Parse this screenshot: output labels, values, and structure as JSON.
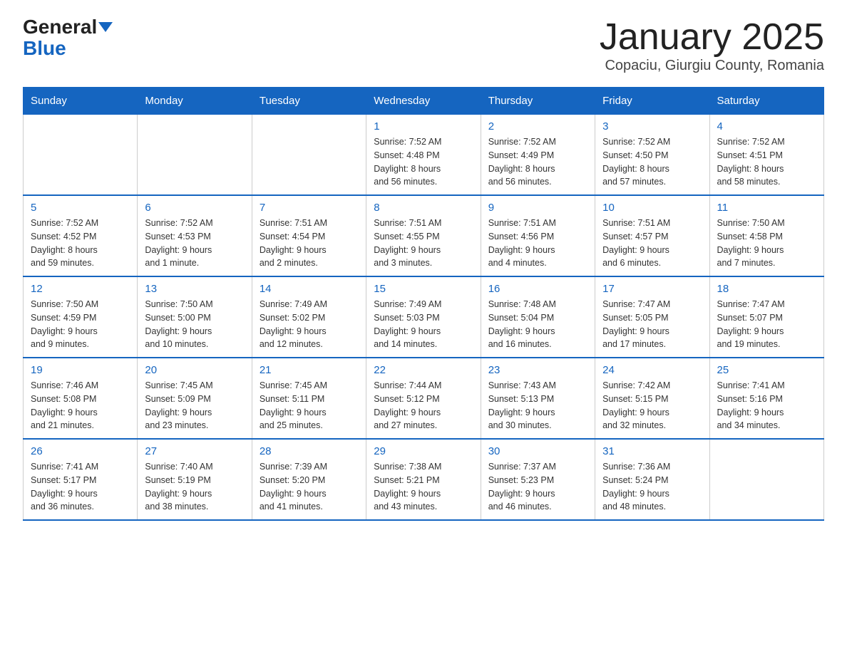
{
  "header": {
    "logo_general": "General",
    "logo_blue": "Blue",
    "title": "January 2025",
    "subtitle": "Copaciu, Giurgiu County, Romania"
  },
  "weekdays": [
    "Sunday",
    "Monday",
    "Tuesday",
    "Wednesday",
    "Thursday",
    "Friday",
    "Saturday"
  ],
  "weeks": [
    [
      {
        "day": "",
        "info": ""
      },
      {
        "day": "",
        "info": ""
      },
      {
        "day": "",
        "info": ""
      },
      {
        "day": "1",
        "info": "Sunrise: 7:52 AM\nSunset: 4:48 PM\nDaylight: 8 hours\nand 56 minutes."
      },
      {
        "day": "2",
        "info": "Sunrise: 7:52 AM\nSunset: 4:49 PM\nDaylight: 8 hours\nand 56 minutes."
      },
      {
        "day": "3",
        "info": "Sunrise: 7:52 AM\nSunset: 4:50 PM\nDaylight: 8 hours\nand 57 minutes."
      },
      {
        "day": "4",
        "info": "Sunrise: 7:52 AM\nSunset: 4:51 PM\nDaylight: 8 hours\nand 58 minutes."
      }
    ],
    [
      {
        "day": "5",
        "info": "Sunrise: 7:52 AM\nSunset: 4:52 PM\nDaylight: 8 hours\nand 59 minutes."
      },
      {
        "day": "6",
        "info": "Sunrise: 7:52 AM\nSunset: 4:53 PM\nDaylight: 9 hours\nand 1 minute."
      },
      {
        "day": "7",
        "info": "Sunrise: 7:51 AM\nSunset: 4:54 PM\nDaylight: 9 hours\nand 2 minutes."
      },
      {
        "day": "8",
        "info": "Sunrise: 7:51 AM\nSunset: 4:55 PM\nDaylight: 9 hours\nand 3 minutes."
      },
      {
        "day": "9",
        "info": "Sunrise: 7:51 AM\nSunset: 4:56 PM\nDaylight: 9 hours\nand 4 minutes."
      },
      {
        "day": "10",
        "info": "Sunrise: 7:51 AM\nSunset: 4:57 PM\nDaylight: 9 hours\nand 6 minutes."
      },
      {
        "day": "11",
        "info": "Sunrise: 7:50 AM\nSunset: 4:58 PM\nDaylight: 9 hours\nand 7 minutes."
      }
    ],
    [
      {
        "day": "12",
        "info": "Sunrise: 7:50 AM\nSunset: 4:59 PM\nDaylight: 9 hours\nand 9 minutes."
      },
      {
        "day": "13",
        "info": "Sunrise: 7:50 AM\nSunset: 5:00 PM\nDaylight: 9 hours\nand 10 minutes."
      },
      {
        "day": "14",
        "info": "Sunrise: 7:49 AM\nSunset: 5:02 PM\nDaylight: 9 hours\nand 12 minutes."
      },
      {
        "day": "15",
        "info": "Sunrise: 7:49 AM\nSunset: 5:03 PM\nDaylight: 9 hours\nand 14 minutes."
      },
      {
        "day": "16",
        "info": "Sunrise: 7:48 AM\nSunset: 5:04 PM\nDaylight: 9 hours\nand 16 minutes."
      },
      {
        "day": "17",
        "info": "Sunrise: 7:47 AM\nSunset: 5:05 PM\nDaylight: 9 hours\nand 17 minutes."
      },
      {
        "day": "18",
        "info": "Sunrise: 7:47 AM\nSunset: 5:07 PM\nDaylight: 9 hours\nand 19 minutes."
      }
    ],
    [
      {
        "day": "19",
        "info": "Sunrise: 7:46 AM\nSunset: 5:08 PM\nDaylight: 9 hours\nand 21 minutes."
      },
      {
        "day": "20",
        "info": "Sunrise: 7:45 AM\nSunset: 5:09 PM\nDaylight: 9 hours\nand 23 minutes."
      },
      {
        "day": "21",
        "info": "Sunrise: 7:45 AM\nSunset: 5:11 PM\nDaylight: 9 hours\nand 25 minutes."
      },
      {
        "day": "22",
        "info": "Sunrise: 7:44 AM\nSunset: 5:12 PM\nDaylight: 9 hours\nand 27 minutes."
      },
      {
        "day": "23",
        "info": "Sunrise: 7:43 AM\nSunset: 5:13 PM\nDaylight: 9 hours\nand 30 minutes."
      },
      {
        "day": "24",
        "info": "Sunrise: 7:42 AM\nSunset: 5:15 PM\nDaylight: 9 hours\nand 32 minutes."
      },
      {
        "day": "25",
        "info": "Sunrise: 7:41 AM\nSunset: 5:16 PM\nDaylight: 9 hours\nand 34 minutes."
      }
    ],
    [
      {
        "day": "26",
        "info": "Sunrise: 7:41 AM\nSunset: 5:17 PM\nDaylight: 9 hours\nand 36 minutes."
      },
      {
        "day": "27",
        "info": "Sunrise: 7:40 AM\nSunset: 5:19 PM\nDaylight: 9 hours\nand 38 minutes."
      },
      {
        "day": "28",
        "info": "Sunrise: 7:39 AM\nSunset: 5:20 PM\nDaylight: 9 hours\nand 41 minutes."
      },
      {
        "day": "29",
        "info": "Sunrise: 7:38 AM\nSunset: 5:21 PM\nDaylight: 9 hours\nand 43 minutes."
      },
      {
        "day": "30",
        "info": "Sunrise: 7:37 AM\nSunset: 5:23 PM\nDaylight: 9 hours\nand 46 minutes."
      },
      {
        "day": "31",
        "info": "Sunrise: 7:36 AM\nSunset: 5:24 PM\nDaylight: 9 hours\nand 48 minutes."
      },
      {
        "day": "",
        "info": ""
      }
    ]
  ]
}
